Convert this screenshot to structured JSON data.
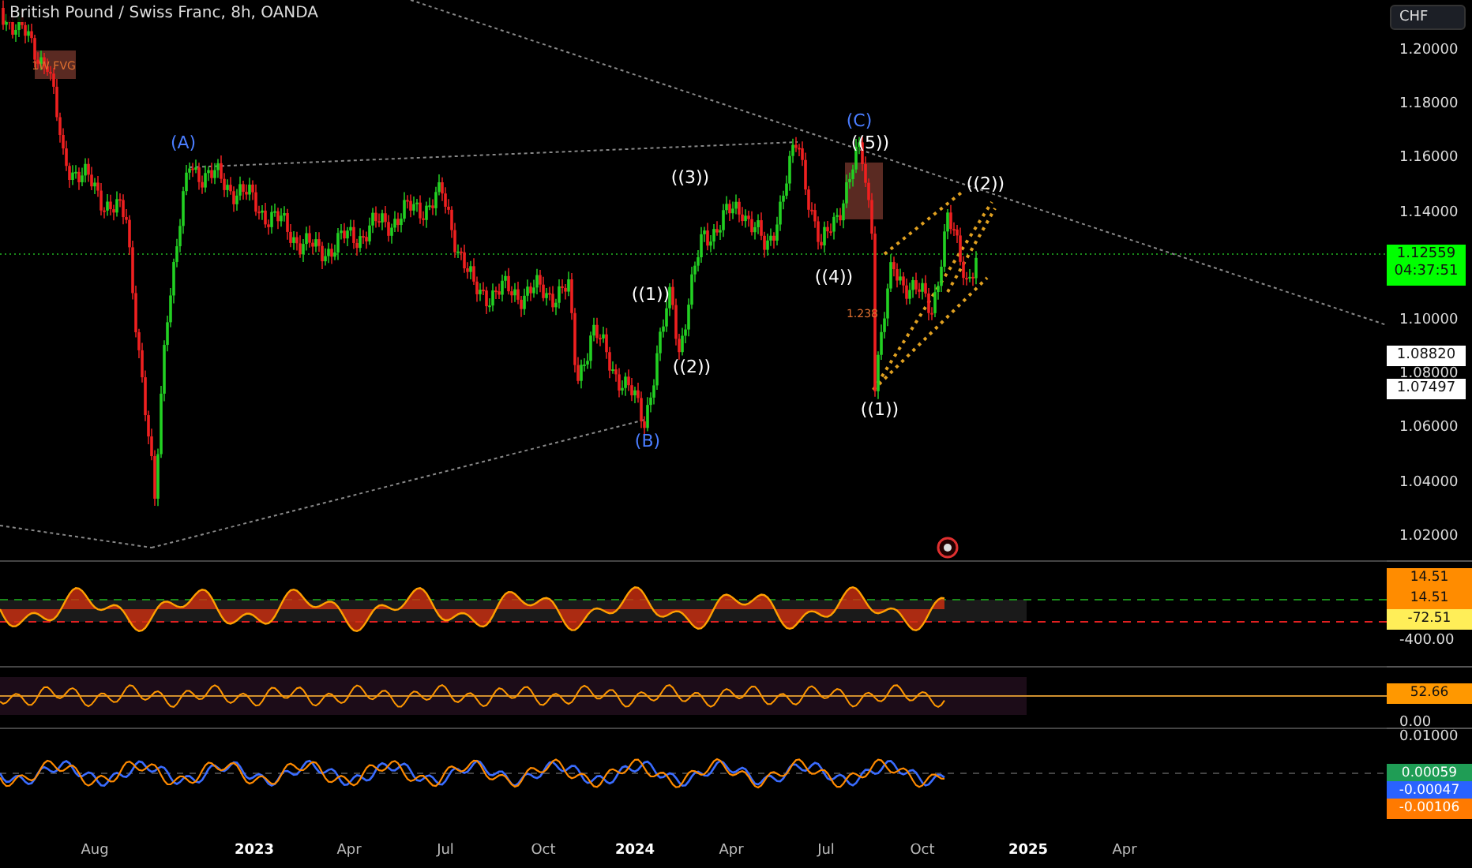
{
  "chart": {
    "title": "British Pound / Swiss Franc, 8h, OANDA",
    "currency": "CHF",
    "zone_labels": [
      "1W FVG",
      "1.238"
    ],
    "wave_labels": [
      {
        "text": "(A)",
        "color": "#4a7dff"
      },
      {
        "text": "(B)",
        "color": "#4a7dff"
      },
      {
        "text": "(C)",
        "color": "#4a7dff"
      },
      {
        "text": "((1))",
        "color": "#ffffff"
      },
      {
        "text": "((2))",
        "color": "#ffffff"
      },
      {
        "text": "((3))",
        "color": "#ffffff"
      },
      {
        "text": "((4))",
        "color": "#ffffff"
      },
      {
        "text": "((5))",
        "color": "#ffffff"
      },
      {
        "text": "((1))",
        "color": "#ffffff"
      },
      {
        "text": "((2))",
        "color": "#ffffff"
      }
    ],
    "price_ticks": [
      "1.20000",
      "1.18000",
      "1.16000",
      "1.14000",
      "1.10000",
      "1.08000",
      "1.06000",
      "1.04000",
      "1.02000"
    ],
    "price_badges": [
      {
        "value": "1.12559",
        "countdown": "04:37:51",
        "color": "#00ff00"
      },
      {
        "value": "1.08820",
        "color": "#ffffff"
      },
      {
        "value": "1.07497",
        "color": "#ffffff"
      }
    ]
  },
  "indicators": [
    {
      "ticks": [
        "-400.00"
      ],
      "badges": [
        {
          "value": "14.51",
          "color": "#ff8c00"
        },
        {
          "value": "14.51",
          "color": "#ff8c00"
        },
        {
          "value": "-72.51",
          "color": "#ffee58"
        }
      ]
    },
    {
      "ticks": [
        "0.00"
      ],
      "badges": [
        {
          "value": "52.66",
          "color": "#ff9800"
        }
      ]
    },
    {
      "ticks": [
        "0.01000"
      ],
      "badges": [
        {
          "value": "0.00059",
          "color": "#1f9d55"
        },
        {
          "value": "-0.00047",
          "color": "#2962ff"
        },
        {
          "value": "-0.00106",
          "color": "#ff7a00"
        }
      ]
    }
  ],
  "time_axis": [
    {
      "label": "Aug",
      "kind": "month"
    },
    {
      "label": "2023",
      "kind": "year"
    },
    {
      "label": "Apr",
      "kind": "month"
    },
    {
      "label": "Jul",
      "kind": "month"
    },
    {
      "label": "Oct",
      "kind": "month"
    },
    {
      "label": "2024",
      "kind": "year"
    },
    {
      "label": "Apr",
      "kind": "month"
    },
    {
      "label": "Jul",
      "kind": "month"
    },
    {
      "label": "Oct",
      "kind": "month"
    },
    {
      "label": "2025",
      "kind": "year"
    },
    {
      "label": "Apr",
      "kind": "month"
    }
  ]
}
